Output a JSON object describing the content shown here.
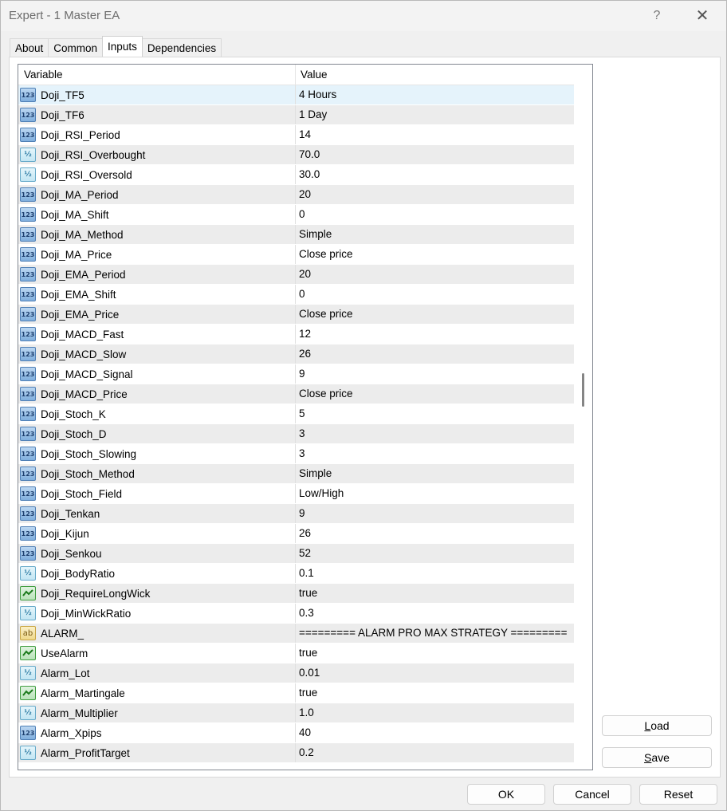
{
  "window": {
    "title": "Expert - 1 Master EA",
    "help_label": "?",
    "close_label": "✕"
  },
  "tabs": [
    {
      "label": "About"
    },
    {
      "label": "Common"
    },
    {
      "label": "Inputs"
    },
    {
      "label": "Dependencies"
    }
  ],
  "grid": {
    "col_variable": "Variable",
    "col_value": "Value",
    "rows": [
      {
        "type": "int",
        "name": "Doji_TF5",
        "value": "4 Hours"
      },
      {
        "type": "int",
        "name": "Doji_TF6",
        "value": "1 Day"
      },
      {
        "type": "int",
        "name": "Doji_RSI_Period",
        "value": "14"
      },
      {
        "type": "double",
        "name": "Doji_RSI_Overbought",
        "value": "70.0"
      },
      {
        "type": "double",
        "name": "Doji_RSI_Oversold",
        "value": "30.0"
      },
      {
        "type": "int",
        "name": "Doji_MA_Period",
        "value": "20"
      },
      {
        "type": "int",
        "name": "Doji_MA_Shift",
        "value": "0"
      },
      {
        "type": "int",
        "name": "Doji_MA_Method",
        "value": "Simple"
      },
      {
        "type": "int",
        "name": "Doji_MA_Price",
        "value": "Close price"
      },
      {
        "type": "int",
        "name": "Doji_EMA_Period",
        "value": "20"
      },
      {
        "type": "int",
        "name": "Doji_EMA_Shift",
        "value": "0"
      },
      {
        "type": "int",
        "name": "Doji_EMA_Price",
        "value": "Close price"
      },
      {
        "type": "int",
        "name": "Doji_MACD_Fast",
        "value": "12"
      },
      {
        "type": "int",
        "name": "Doji_MACD_Slow",
        "value": "26"
      },
      {
        "type": "int",
        "name": "Doji_MACD_Signal",
        "value": "9"
      },
      {
        "type": "int",
        "name": "Doji_MACD_Price",
        "value": "Close price"
      },
      {
        "type": "int",
        "name": "Doji_Stoch_K",
        "value": "5"
      },
      {
        "type": "int",
        "name": "Doji_Stoch_D",
        "value": "3"
      },
      {
        "type": "int",
        "name": "Doji_Stoch_Slowing",
        "value": "3"
      },
      {
        "type": "int",
        "name": "Doji_Stoch_Method",
        "value": "Simple"
      },
      {
        "type": "int",
        "name": "Doji_Stoch_Field",
        "value": "Low/High"
      },
      {
        "type": "int",
        "name": "Doji_Tenkan",
        "value": "9"
      },
      {
        "type": "int",
        "name": "Doji_Kijun",
        "value": "26"
      },
      {
        "type": "int",
        "name": "Doji_Senkou",
        "value": "52"
      },
      {
        "type": "double",
        "name": "Doji_BodyRatio",
        "value": "0.1"
      },
      {
        "type": "bool",
        "name": "Doji_RequireLongWick",
        "value": "true"
      },
      {
        "type": "double",
        "name": "Doji_MinWickRatio",
        "value": "0.3"
      },
      {
        "type": "string",
        "name": "ALARM_",
        "value": "========= ALARM PRO MAX STRATEGY ========="
      },
      {
        "type": "bool",
        "name": "UseAlarm",
        "value": "true"
      },
      {
        "type": "double",
        "name": "Alarm_Lot",
        "value": "0.01"
      },
      {
        "type": "bool",
        "name": "Alarm_Martingale",
        "value": "true"
      },
      {
        "type": "double",
        "name": "Alarm_Multiplier",
        "value": "1.0"
      },
      {
        "type": "int",
        "name": "Alarm_Xpips",
        "value": "40"
      },
      {
        "type": "double",
        "name": "Alarm_ProfitTarget",
        "value": "0.2"
      }
    ],
    "selected_row": 0,
    "scroll_fraction": 0.46
  },
  "icons": {
    "int": "123",
    "double": "½",
    "string": "ab"
  },
  "buttons": {
    "load": {
      "prefix": "",
      "accel": "L",
      "rest": "oad"
    },
    "save": {
      "prefix": "",
      "accel": "S",
      "rest": "ave"
    },
    "ok": "OK",
    "cancel": "Cancel",
    "reset": "Reset"
  }
}
